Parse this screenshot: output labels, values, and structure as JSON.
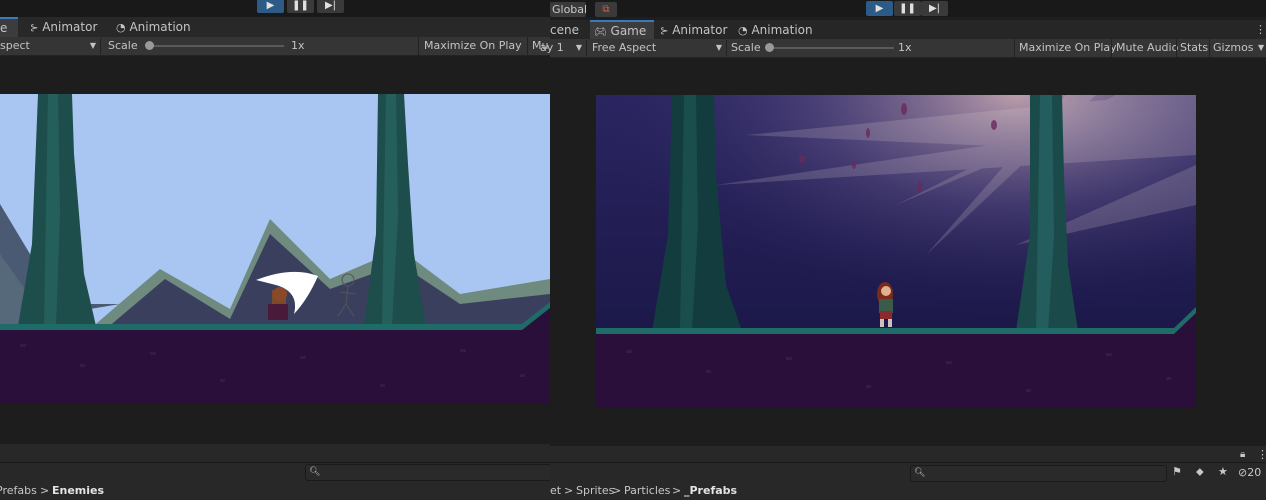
{
  "left_panel": {
    "tabs": [
      {
        "label": "e"
      },
      {
        "label": "Animator"
      },
      {
        "label": "Animation"
      }
    ],
    "toolbar": {
      "aspect_label": "spect",
      "scale_label": "Scale",
      "scale_value": "1x",
      "maximize_label": "Maximize On Play",
      "mute_label": "Mu"
    },
    "breadcrumb": {
      "prefix": "Prefabs",
      "sep": ">",
      "current": "Enemies"
    }
  },
  "right_panel": {
    "top": {
      "global_label": "Global"
    },
    "tabs": [
      {
        "label": "cene"
      },
      {
        "label": "Game"
      },
      {
        "label": "Animator"
      },
      {
        "label": "Animation"
      }
    ],
    "toolbar": {
      "display_label": "ay 1",
      "aspect_label": "Free Aspect",
      "scale_label": "Scale",
      "scale_value": "1x",
      "maximize_label": "Maximize On Play",
      "mute_label": "Mute Audio",
      "stats_label": "Stats",
      "gizmos_label": "Gizmos"
    },
    "breadcrumb": [
      "et",
      "Sprites",
      "Particles",
      "_Prefabs"
    ],
    "breadcrumb_sep": ">",
    "count": "20"
  },
  "icons": [
    "play-icon",
    "pause-icon",
    "step-icon",
    "search-icon",
    "lock-icon",
    "kebab-icon",
    "game-controller-icon",
    "animator-icon",
    "animation-clock-icon"
  ],
  "colors": {
    "accent": "#3a79bb",
    "play_active": "#2d5b87",
    "sky_day": "#a9c6f2",
    "sky_night": "#1e1a52",
    "ground": "#2a0f3a",
    "grass": "#1f6b68"
  }
}
